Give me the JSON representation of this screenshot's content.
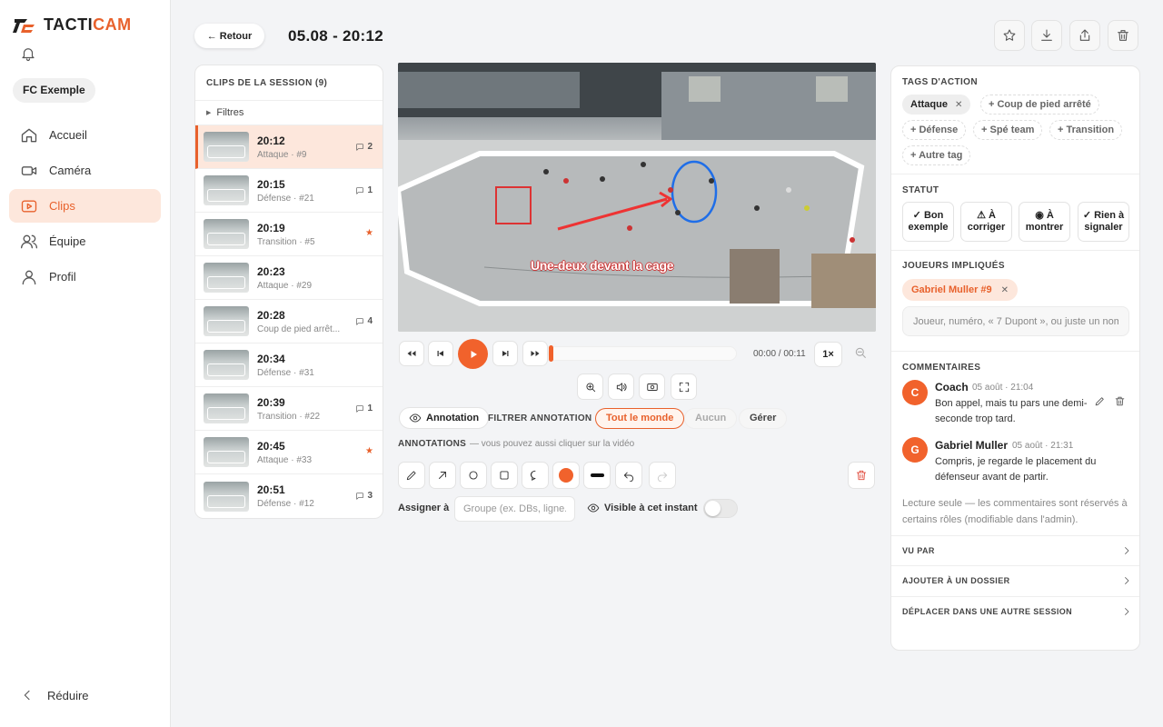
{
  "app": {
    "logo_prefix": "TACTI",
    "logo_suffix": "CAM",
    "club": "FC Exemple"
  },
  "nav": {
    "items": [
      {
        "label": "Accueil",
        "icon": "home-icon"
      },
      {
        "label": "Caméra",
        "icon": "camera-icon"
      },
      {
        "label": "Clips",
        "icon": "play-icon",
        "active": true
      },
      {
        "label": "Équipe",
        "icon": "team-icon"
      },
      {
        "label": "Profil",
        "icon": "user-icon"
      }
    ],
    "collapse": "Réduire"
  },
  "header": {
    "back": "← Retour",
    "title": "05.08 - 20:12",
    "actions": [
      "star-icon",
      "download-icon",
      "share-icon",
      "trash-icon"
    ]
  },
  "clips": {
    "title": "CLIPS DE LA SESSION (9)",
    "filters": "Filtres",
    "items": [
      {
        "time": "20:12",
        "sub": "Attaque · #9",
        "badge": "2",
        "selected": true
      },
      {
        "time": "20:15",
        "sub": "Défense · #21",
        "badge": "1"
      },
      {
        "time": "20:19",
        "sub": "Transition · #5",
        "badge": "★"
      },
      {
        "time": "20:23",
        "sub": "Attaque · #29",
        "badge": ""
      },
      {
        "time": "20:28",
        "sub": "Coup de pied arrêt...",
        "badge": "4"
      },
      {
        "time": "20:34",
        "sub": "Défense · #31",
        "badge": ""
      },
      {
        "time": "20:39",
        "sub": "Transition · #22",
        "badge": "1"
      },
      {
        "time": "20:45",
        "sub": "Attaque · #33",
        "badge": "★"
      },
      {
        "time": "20:51",
        "sub": "Défense · #12",
        "badge": "3"
      }
    ]
  },
  "video": {
    "caption": "Une-deux devant la cage",
    "time": "00:00 / 00:11",
    "speed": "1×",
    "progress": 0.0
  },
  "annotation": {
    "toggle": "Annotation",
    "filter_label": "FILTRER ANNOTATION",
    "chip_all": "Tout le monde",
    "chip_none": "Aucun",
    "chip_manage": "Gérer",
    "title": "ANNOTATIONS",
    "hint": "— vous pouvez aussi cliquer sur la vidéo",
    "accent": "#f1622c",
    "assign_label": "Assigner à",
    "assign_placeholder": "Groupe (ex. DBs, ligne...)",
    "visible_label": "Visible à cet instant"
  },
  "tags": {
    "title": "TAGS D'ACTION",
    "active": "Attaque",
    "items": [
      "+ Coup de pied arrêté",
      "+ Défense",
      "+ Spé team",
      "+ Transition",
      "+ Autre tag"
    ]
  },
  "status": {
    "title": "STATUT",
    "items": [
      {
        "l1": "✓ Bon",
        "l2": "exemple"
      },
      {
        "l1": "⚠ À",
        "l2": "corriger"
      },
      {
        "l1": "◉ À",
        "l2": "montrer"
      },
      {
        "l1": "✓ Rien à",
        "l2": "signaler"
      }
    ]
  },
  "players": {
    "title": "JOUEURS IMPLIQUÉS",
    "chip": "Gabriel Muller #9",
    "placeholder": "Joueur, numéro, « 7 Dupont », ou juste un nom"
  },
  "comments": {
    "title": "COMMENTAIRES",
    "items": [
      {
        "initial": "C",
        "author": "Coach",
        "date": "05 août · 21:04",
        "text": "Bon appel, mais tu pars une demi-seconde trop tard."
      },
      {
        "initial": "G",
        "author": "Gabriel Muller",
        "date": "05 août · 21:31",
        "text": "Compris, je regarde le placement du défenseur avant de partir."
      }
    ],
    "readonly": "Lecture seule — les commentaires sont réservés à certains rôles (modifiable dans l'admin)."
  },
  "links": [
    "VU PAR",
    "AJOUTER À UN DOSSIER",
    "DÉPLACER DANS UNE AUTRE SESSION"
  ]
}
